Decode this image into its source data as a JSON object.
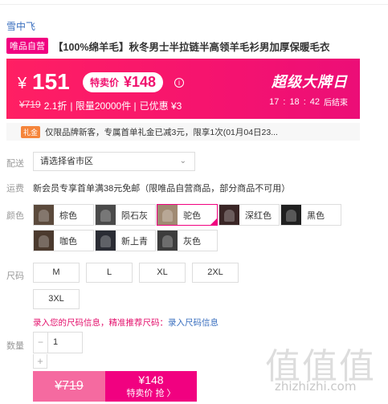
{
  "brand": "雪中飞",
  "product": {
    "tag": "唯品自营",
    "title": "【100%绵羊毛】秋冬男士半拉链半高领羊毛衫男加厚保暖毛衣"
  },
  "price": {
    "currency": "¥",
    "current": "151",
    "special_label": "特卖价",
    "special_price": "¥148",
    "original": "¥719",
    "discount": "2.1折",
    "limit": "| 限量20000件 |",
    "saved": "已优惠 ¥3",
    "event": "超级大牌日",
    "countdown": [
      "17",
      ":",
      "18",
      ":",
      "42"
    ],
    "ends": "后结束"
  },
  "coupon": {
    "tag": "礼金",
    "text": "仅限品牌新客，专属首单礼金已减3元，限享1次(01月04日23..."
  },
  "labels": {
    "delivery": "配送",
    "shipping": "运费",
    "color": "颜色",
    "size": "尺码",
    "quantity": "数量"
  },
  "delivery": {
    "placeholder": "请选择省市区"
  },
  "shipping": {
    "text": "新会员专享首单满38元免邮（限唯品自营商品，部分商品不可用）"
  },
  "colors": [
    {
      "name": "棕色",
      "swatch": "#5b4a3c"
    },
    {
      "name": "陨石灰",
      "swatch": "#4a4a4a"
    },
    {
      "name": "驼色",
      "swatch": "#a08a73"
    },
    {
      "name": "深红色",
      "swatch": "#3a2626"
    },
    {
      "name": "黑色",
      "swatch": "#202020"
    },
    {
      "name": "咖色",
      "swatch": "#4b3a2e"
    },
    {
      "name": "新上青",
      "swatch": "#2a2c34"
    },
    {
      "name": "灰色",
      "swatch": "#3c3c3c"
    }
  ],
  "selected_color": "驼色",
  "sizes": [
    "M",
    "L",
    "XL",
    "2XL",
    "3XL"
  ],
  "size_links": {
    "enter": "录入您的尺码信息，精准推荐尺码：",
    "action": "录入尺码信息"
  },
  "quantity": {
    "value": "1",
    "minus": "−",
    "plus": "+"
  },
  "buy": {
    "original": "¥719",
    "price": "¥148",
    "label": "特卖价 抢 〉"
  },
  "watermark": {
    "chars": "值值值",
    "url": "zhizhizhi.com"
  }
}
